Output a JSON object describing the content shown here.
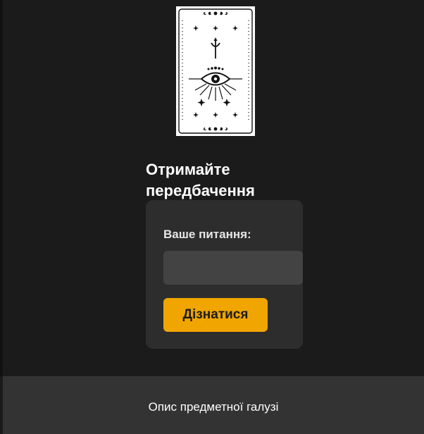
{
  "hero": {
    "card_image": "tarot-card-eye-moon",
    "title": "Отримайте передбачення"
  },
  "form": {
    "question_label": "Ваше питання:",
    "question_value": "",
    "submit_label": "Дізнатися"
  },
  "footer": {
    "domain_link": "Опис предметної галузі"
  },
  "colors": {
    "background": "#1b1b1b",
    "card": "#2d2d2d",
    "input": "#434343",
    "accent": "#f0a500",
    "footer": "#333333"
  }
}
